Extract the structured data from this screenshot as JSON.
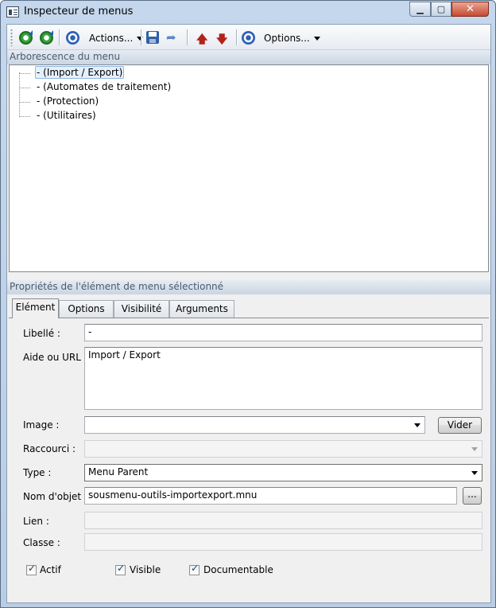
{
  "window": {
    "title": "Inspecteur de menus"
  },
  "toolbar": {
    "actions_label": "Actions...",
    "options_label": "Options..."
  },
  "tree": {
    "header": "Arborescence du menu",
    "items": [
      {
        "label": "- (Import / Export)",
        "selected": true
      },
      {
        "label": "- (Automates de traitement)",
        "selected": false
      },
      {
        "label": "- (Protection)",
        "selected": false
      },
      {
        "label": "- (Utilitaires)",
        "selected": false
      }
    ]
  },
  "properties": {
    "header": "Propriétés de l'élément de menu sélectionné",
    "tabs": [
      "Elément",
      "Options",
      "Visibilité",
      "Arguments"
    ],
    "active_tab": "Elément"
  },
  "form": {
    "libelle": {
      "label": "Libellé :",
      "value": "-"
    },
    "aide": {
      "label": "Aide ou URL :",
      "value": "Import / Export"
    },
    "image": {
      "label": "Image :",
      "value": "",
      "button": "Vider"
    },
    "raccourci": {
      "label": "Raccourci :",
      "value": ""
    },
    "type": {
      "label": "Type :",
      "value": "Menu Parent"
    },
    "nom_objet": {
      "label": "Nom d'objet :",
      "value": "sousmenu-outils-importexport.mnu",
      "button": "..."
    },
    "lien": {
      "label": "Lien :",
      "value": ""
    },
    "classe": {
      "label": "Classe :",
      "value": ""
    }
  },
  "checkboxes": [
    {
      "label": "Actif",
      "checked": true
    },
    {
      "label": "Visible",
      "checked": true
    },
    {
      "label": "Documentable",
      "checked": true
    }
  ]
}
